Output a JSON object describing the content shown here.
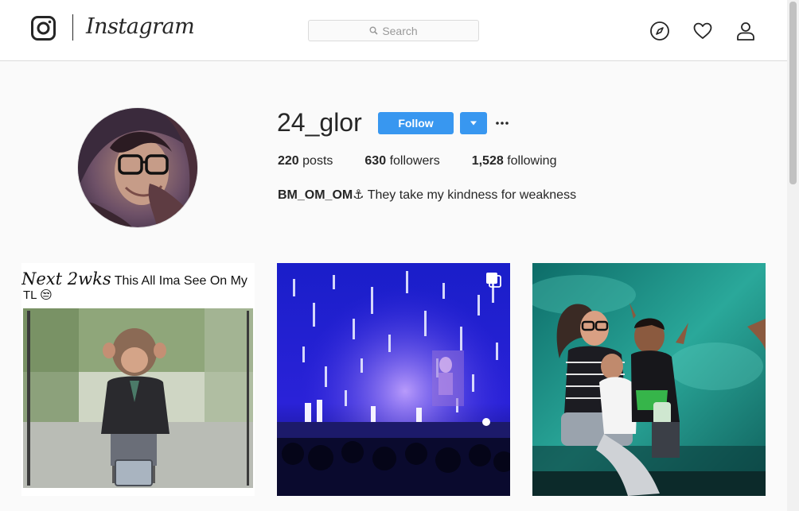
{
  "header": {
    "brand": "Instagram",
    "search_placeholder": "Search",
    "icons": [
      "instagram-glyph-icon",
      "search-icon",
      "compass-icon",
      "heart-icon",
      "person-icon"
    ]
  },
  "profile": {
    "username": "24_glor",
    "follow_label": "Follow",
    "stats": {
      "posts_count": "220",
      "posts_label": "posts",
      "followers_count": "630",
      "followers_label": "followers",
      "following_count": "1,528",
      "following_label": "following"
    },
    "bio_name": "BM_OM_OM",
    "bio_text": "⚓ They take my kindness for weakness"
  },
  "posts": [
    {
      "caption_handwritten": "Next 2wks",
      "caption_text": "This All Ima See On My",
      "caption_line2": "TL 😒"
    },
    {
      "multiple_photos": true
    },
    {}
  ],
  "colors": {
    "accent": "#3897f0",
    "background": "#fafafa",
    "border": "#dbdbdb",
    "text": "#262626"
  }
}
